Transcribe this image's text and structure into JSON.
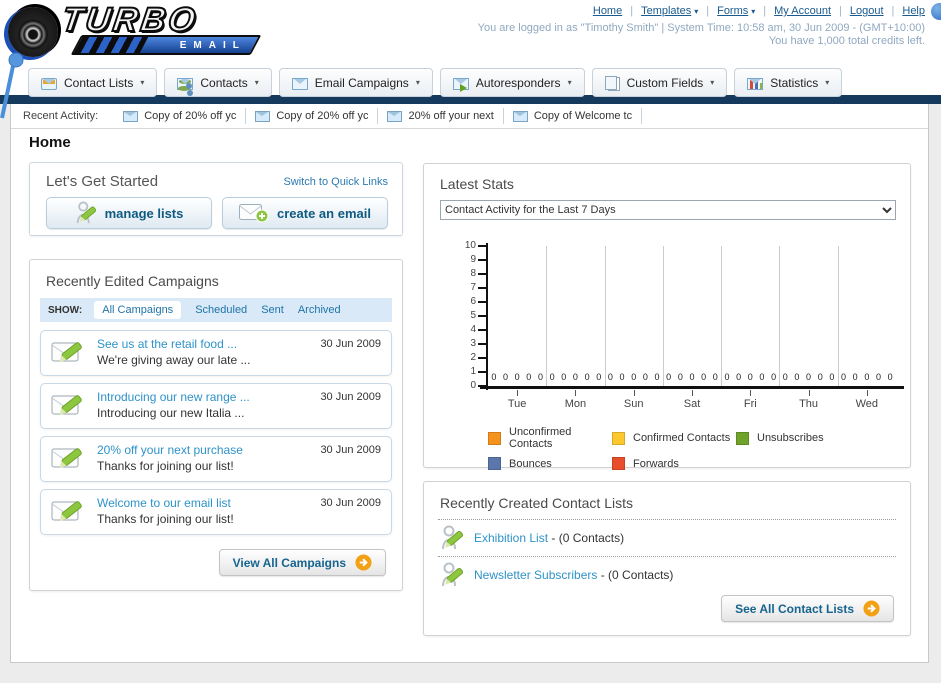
{
  "header": {
    "logo_title": "TURBO",
    "logo_subtitle": "EMAIL",
    "nav_links": [
      {
        "label": "Home",
        "dropdown": false
      },
      {
        "label": "Templates",
        "dropdown": true
      },
      {
        "label": "Forms",
        "dropdown": true
      },
      {
        "label": "My Account",
        "dropdown": false
      },
      {
        "label": "Logout",
        "dropdown": false
      },
      {
        "label": "Help",
        "dropdown": false
      }
    ],
    "login_line": "You are logged in as \"Timothy Smith\" | System Time: 10:58 am, 30 Jun 2009 - (GMT+10:00)",
    "credits_line": "You have 1,000 total credits left."
  },
  "nav_tabs": [
    {
      "label": "Contact Lists",
      "icon": "contact-lists-icon"
    },
    {
      "label": "Contacts",
      "icon": "contacts-icon"
    },
    {
      "label": "Email Campaigns",
      "icon": "email-campaigns-icon"
    },
    {
      "label": "Autoresponders",
      "icon": "autoresponders-icon"
    },
    {
      "label": "Custom Fields",
      "icon": "custom-fields-icon"
    },
    {
      "label": "Statistics",
      "icon": "statistics-icon"
    }
  ],
  "recent_activity": {
    "label": "Recent Activity:",
    "items": [
      "Copy of 20% off yc",
      "Copy of 20% off yc",
      "20% off your next",
      "Copy of Welcome tc"
    ]
  },
  "page_title": "Home",
  "get_started": {
    "title": "Let's Get Started",
    "switch_link": "Switch to Quick Links",
    "manage_lists_button": "manage lists",
    "create_email_button": "create an email"
  },
  "campaigns": {
    "title": "Recently Edited Campaigns",
    "show_label": "SHOW:",
    "filters": [
      {
        "label": "All Campaigns",
        "active": true
      },
      {
        "label": "Scheduled",
        "active": false
      },
      {
        "label": "Sent",
        "active": false
      },
      {
        "label": "Archived",
        "active": false
      }
    ],
    "items": [
      {
        "title": "See us at the retail food ...",
        "subtitle": "We're giving away our late ...",
        "date": "30 Jun 2009"
      },
      {
        "title": "Introducing our new range ...",
        "subtitle": "Introducing our new Italia ...",
        "date": "30 Jun 2009"
      },
      {
        "title": "20% off your next purchase",
        "subtitle": "Thanks for joining our list!",
        "date": "30 Jun 2009"
      },
      {
        "title": "Welcome to our email list",
        "subtitle": "Thanks for joining our list!",
        "date": "30 Jun 2009"
      }
    ],
    "view_all_button": "View All Campaigns"
  },
  "stats": {
    "title": "Latest Stats",
    "dropdown_value": "Contact Activity for the Last 7 Days"
  },
  "chart_data": {
    "type": "bar",
    "title": "Contact Activity for the Last 7 Days",
    "categories": [
      "Tue",
      "Mon",
      "Sun",
      "Sat",
      "Fri",
      "Thu",
      "Wed"
    ],
    "series": [
      {
        "name": "Unconfirmed Contacts",
        "color": "#f6921e",
        "values": [
          0,
          0,
          0,
          0,
          0,
          0,
          0
        ]
      },
      {
        "name": "Confirmed Contacts",
        "color": "#fdc72f",
        "values": [
          0,
          0,
          0,
          0,
          0,
          0,
          0
        ]
      },
      {
        "name": "Unsubscribes",
        "color": "#6fa32a",
        "values": [
          0,
          0,
          0,
          0,
          0,
          0,
          0
        ]
      },
      {
        "name": "Bounces",
        "color": "#5b76ad",
        "values": [
          0,
          0,
          0,
          0,
          0,
          0,
          0
        ]
      },
      {
        "name": "Forwards",
        "color": "#e94e2c",
        "values": [
          0,
          0,
          0,
          0,
          0,
          0,
          0
        ]
      }
    ],
    "ylim": [
      0,
      10
    ],
    "yticks": [
      0,
      1,
      2,
      3,
      4,
      5,
      6,
      7,
      8,
      9,
      10
    ],
    "grid": "vertical-group-separators",
    "legend_position": "bottom"
  },
  "contact_lists": {
    "title": "Recently Created Contact Lists",
    "items": [
      {
        "name": "Exhibition List",
        "count": "(0 Contacts)"
      },
      {
        "name": "Newsletter Subscribers",
        "count": "(0 Contacts)"
      }
    ],
    "see_all_button": "See All Contact Lists"
  },
  "colors": {
    "navy_bar": "#16395e",
    "link_blue": "#1f74a8",
    "panel_border": "#d2d2d2",
    "show_bar_bg": "#d9e9f7",
    "button_text": "#0f5a80",
    "arrow_circle": "#f2a114"
  }
}
